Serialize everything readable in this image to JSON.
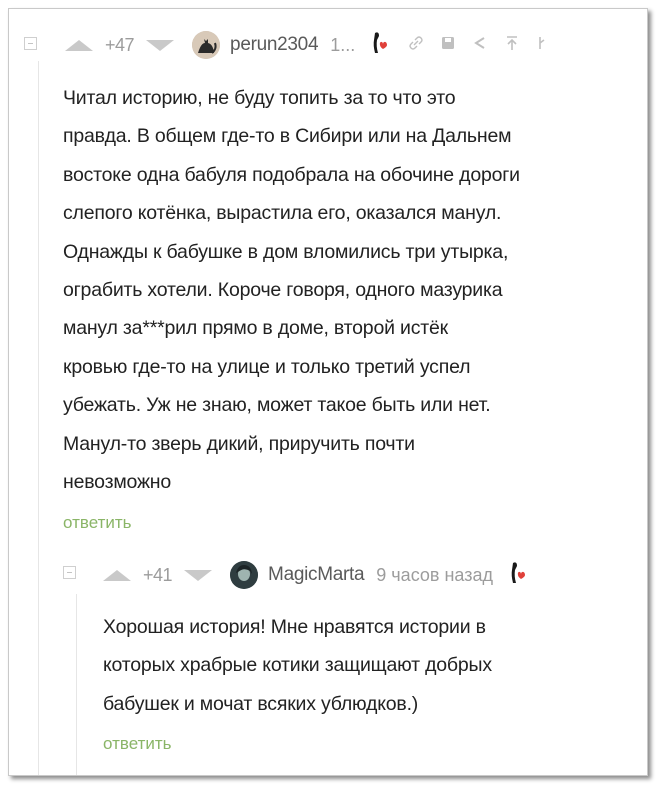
{
  "comments": [
    {
      "rating": "+47",
      "username": "perun2304",
      "time": "1...",
      "text_lines": [
        "Читал историю, не буду топить за то что это",
        "правда. В общем где-то в Сибири или на Дальнем",
        "востоке одна бабуля подобрала на обочине дороги",
        "слепого котёнка, вырастила его, оказался манул.",
        "Однажды к бабушке в дом вломились три утырка,",
        "ограбить хотели. Короче говоря, одного мазурика",
        "манул за***рил прямо в доме, второй истёк",
        "кровью где-то на улице и только третий успел",
        "убежать. Уж не знаю, может такое быть или нет.",
        "Манул-то зверь дикий, приручить почти",
        "невозможно"
      ],
      "reply_label": "ответить"
    },
    {
      "rating": "+41",
      "username": "MagicMarta",
      "time": "9 часов назад",
      "text_lines": [
        "Хорошая история! Мне нравятся истории в",
        "которых храбрые котики защищают добрых",
        "бабушек и мочат всяких ублюдков.)"
      ],
      "reply_label": "ответить"
    }
  ],
  "colors": {
    "reply_link": "#8ab567",
    "vote_arrow": "#c9c9c9",
    "meta_text": "#9c9c9c",
    "heart": "#e0403a"
  },
  "icons": [
    "collapse-icon",
    "vote-up-icon",
    "vote-down-icon",
    "avatar-cat",
    "avatar-girl",
    "badge-icon",
    "link-icon",
    "save-icon",
    "share-icon",
    "up-arrow-icon",
    "more-icon"
  ]
}
